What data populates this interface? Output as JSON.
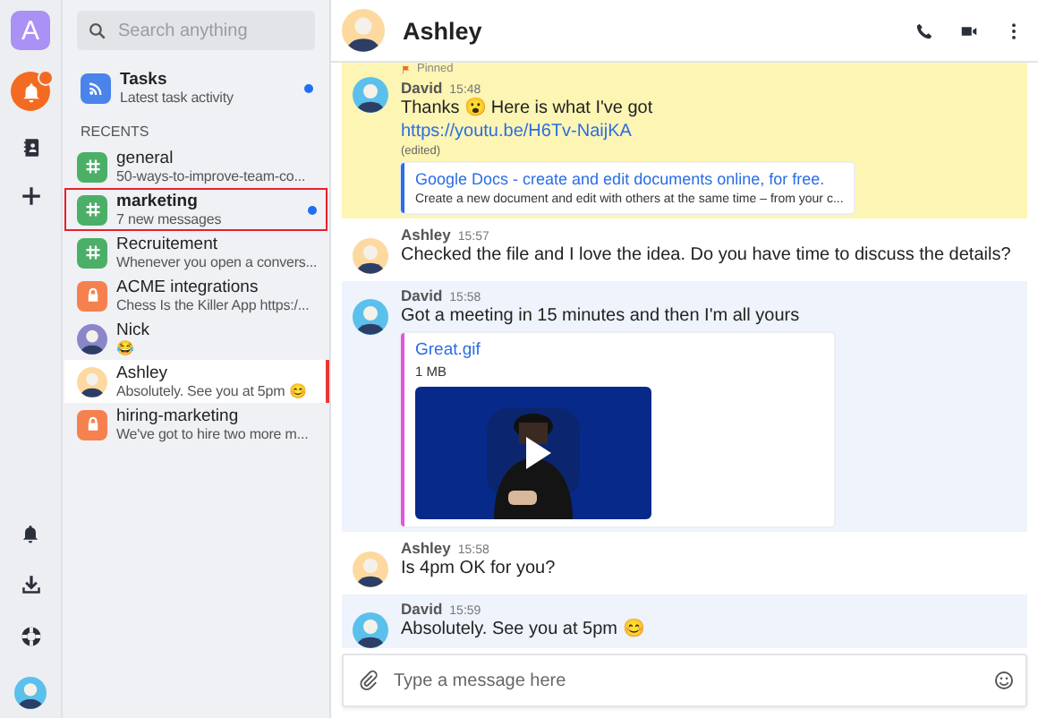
{
  "rail": {
    "workspace_initial": "A",
    "notification_badge": true
  },
  "sidebar": {
    "search": {
      "placeholder": "Search anything"
    },
    "tasks": {
      "title": "Tasks",
      "subtitle": "Latest task activity",
      "unread": true
    },
    "section_label": "RECENTS",
    "items": [
      {
        "kind": "channel",
        "name": "general",
        "preview": "50-ways-to-improve-team-co...",
        "unread": false,
        "selected": false,
        "outlined": false
      },
      {
        "kind": "channel",
        "name": "marketing",
        "preview": "7 new messages",
        "unread": true,
        "selected": false,
        "outlined": true
      },
      {
        "kind": "channel",
        "name": "Recruitement",
        "preview": "Whenever you open a convers...",
        "unread": false,
        "selected": false,
        "outlined": false
      },
      {
        "kind": "private",
        "name": "ACME integrations",
        "preview": "Chess Is the Killer App https:/...",
        "unread": false,
        "selected": false,
        "outlined": false
      },
      {
        "kind": "person",
        "name": "Nick",
        "preview": "😂",
        "unread": false,
        "selected": false,
        "outlined": false
      },
      {
        "kind": "person",
        "name": "Ashley",
        "preview": "Absolutely. See you at 5pm 😊",
        "unread": false,
        "selected": true,
        "outlined": false
      },
      {
        "kind": "private",
        "name": "hiring-marketing",
        "preview": "We've got to hire two more m...",
        "unread": false,
        "selected": false,
        "outlined": false
      }
    ]
  },
  "conversation": {
    "title": "Ashley",
    "messages": [
      {
        "kind": "pinned",
        "pinned_label": "Pinned",
        "author": "David",
        "color": "#5bc0eb",
        "time": "15:48",
        "text": "Thanks 😮 Here is what I've got",
        "link": "https://youtu.be/H6Tv-NaijKA",
        "edited": "(edited)",
        "preview": {
          "title": "Google Docs - create and edit documents online, for free.",
          "description": "Create a new document and edit with others at the same time – from your c..."
        }
      },
      {
        "kind": "plain",
        "author": "Ashley",
        "color": "#fdd9a0",
        "time": "15:57",
        "text": "Checked the file and I love the idea. Do you have time to discuss the details?"
      },
      {
        "kind": "shaded",
        "author": "David",
        "color": "#5bc0eb",
        "time": "15:58",
        "text": "Got a meeting in 15 minutes and then I'm all yours",
        "attachment": {
          "name": "Great.gif",
          "size": "1 MB",
          "kind": "picture"
        }
      },
      {
        "kind": "plain",
        "author": "Ashley",
        "color": "#fdd9a0",
        "time": "15:58",
        "text": "Is 4pm OK for you?"
      },
      {
        "kind": "shaded",
        "author": "David",
        "color": "#5bc0eb",
        "time": "15:59",
        "text": "Absolutely. See you at 5pm 😊"
      }
    ],
    "composer": {
      "placeholder": "Type a message here"
    }
  }
}
